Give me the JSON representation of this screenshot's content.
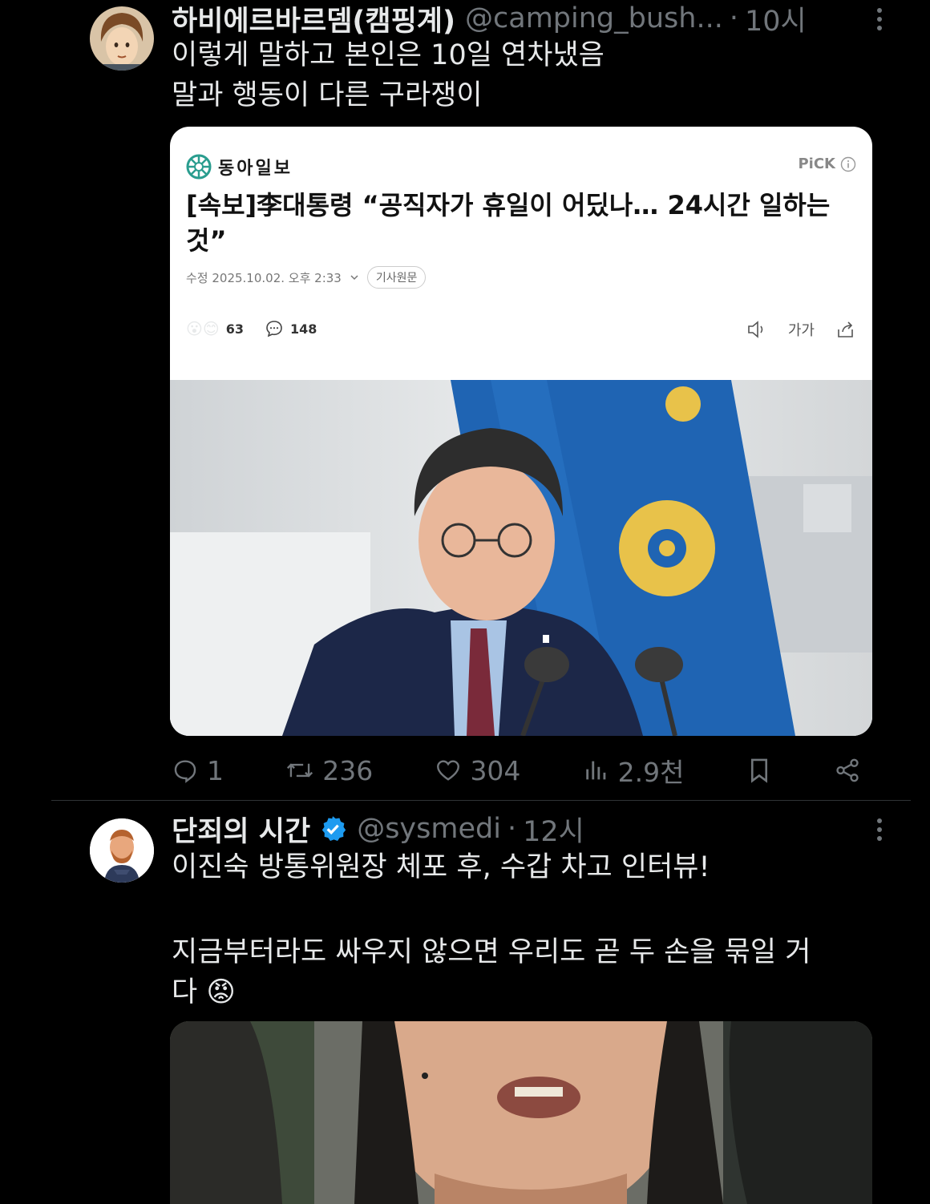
{
  "tweet1": {
    "name": "하비에르바르뎀(캠핑계)",
    "handle": "@camping_bush...",
    "dot": "·",
    "time": "10시",
    "lines": [
      "이렇게 말하고 본인은 10일 연차냈음",
      "말과 행동이 다른 구라쟁이"
    ],
    "card": {
      "publisher": "동아일보",
      "pick_label": "PiCK",
      "headline": "[속보]李대통령 “공직자가 휴일이 어딨나… 24시간 일하는 것”",
      "modified": "수정 2025.10.02. 오후 2:33",
      "original_label": "기사원문",
      "reaction_count": "63",
      "comment_count": "148",
      "font_label": "가가"
    },
    "actions": {
      "replies": "1",
      "retweets": "236",
      "likes": "304",
      "views": "2.9천"
    }
  },
  "tweet2": {
    "name": "단죄의 시간",
    "handle": "@sysmedi",
    "dot": "·",
    "time": "12시",
    "line1": "이진숙 방통위원장 체포 후, 수갑 차고 인터뷰!",
    "line2": "지금부터라도 싸우지 않으면 우리도 곧 두 손을 묶일 거",
    "line3": "다 😡"
  },
  "colors": {
    "background": "#000000",
    "text_primary": "#e7e9ea",
    "text_secondary": "#71767b",
    "verified": "#1d9bf0",
    "divider": "#2f3336"
  }
}
